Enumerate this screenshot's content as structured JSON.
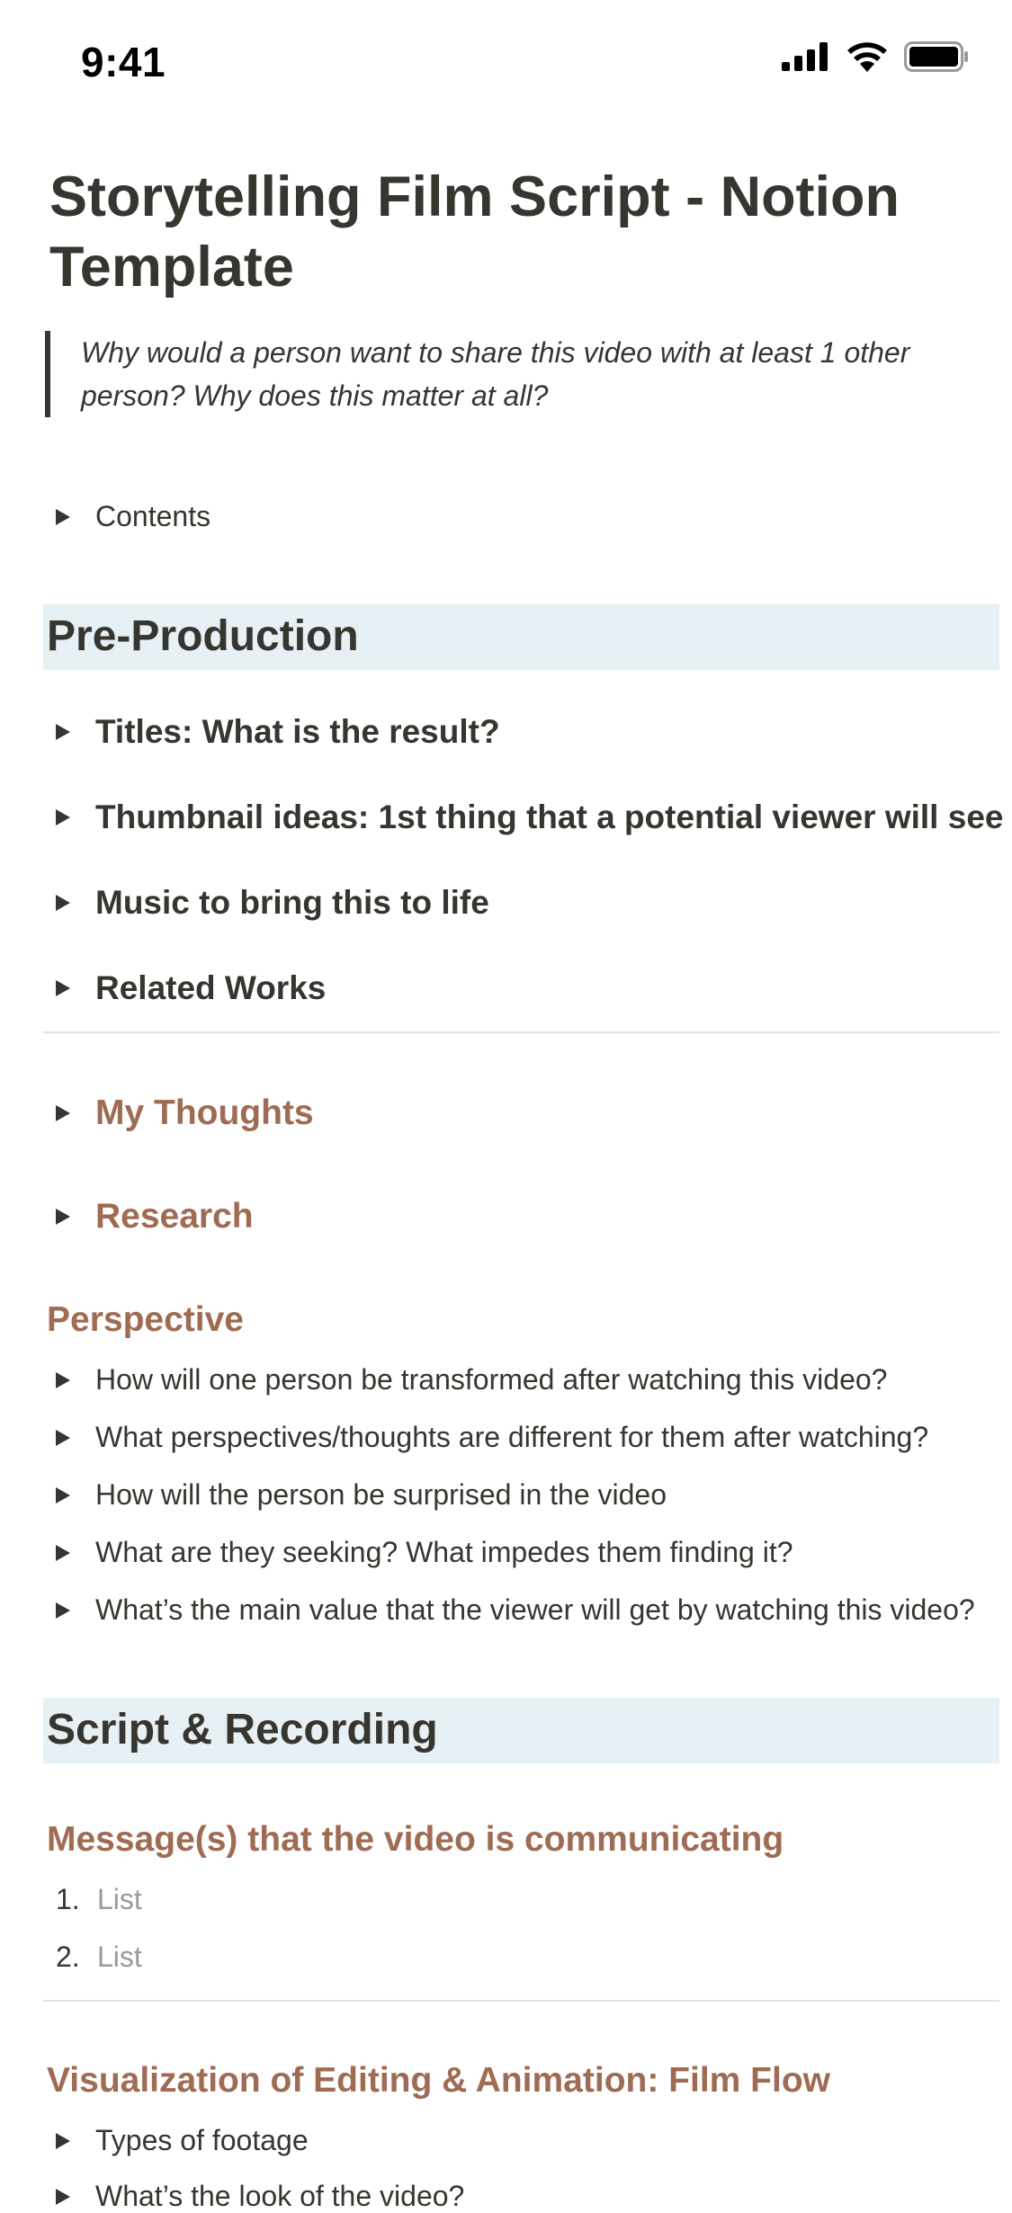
{
  "status_bar": {
    "time": "9:41"
  },
  "page": {
    "title": "Storytelling Film Script - Notion Template",
    "quote": "Why would a person want to share this video with at least 1 other person? Why does this matter at all?",
    "contents_toggle": "Contents"
  },
  "pre_production": {
    "heading": "Pre-Production",
    "toggles": [
      "Titles: What is the result?",
      "Thumbnail ideas: 1st thing that a potential viewer will see",
      "Music to bring this to life",
      "Related Works"
    ],
    "brown_toggles": [
      "My Thoughts",
      "Research"
    ]
  },
  "perspective": {
    "heading": "Perspective",
    "items": [
      "How will one person be transformed after watching this video?",
      "What perspectives/thoughts are different for them after watching?",
      "How will the person be surprised in the video",
      "What are they seeking? What impedes them finding it?",
      "What’s the main value that the viewer will get by watching this video?"
    ]
  },
  "script_recording": {
    "heading": "Script & Recording",
    "messages_heading": "Message(s) that the video is communicating",
    "list": [
      {
        "num": "1.",
        "text": "List"
      },
      {
        "num": "2.",
        "text": "List"
      }
    ],
    "visualization_heading": "Visualization of Editing & Animation: Film Flow",
    "visualization_items": [
      "Types of footage",
      "What’s the look of the video?"
    ]
  }
}
